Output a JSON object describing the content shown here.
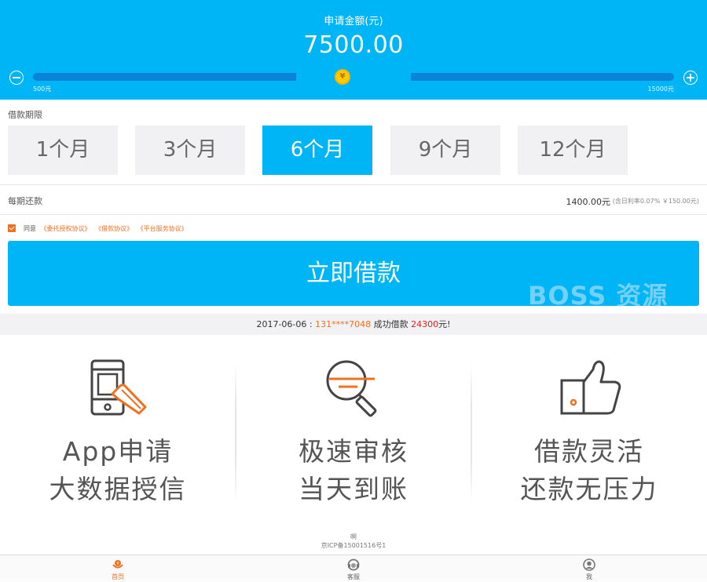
{
  "amount": {
    "title": "申请金额(元)",
    "value": "7500.00",
    "min_label": "500元",
    "max_label": "15000元",
    "coin_symbol": "¥",
    "slider_fraction": 0.48
  },
  "term": {
    "label": "借款期限",
    "options": [
      "1个月",
      "3个月",
      "6个月",
      "9个月",
      "12个月"
    ],
    "selected_index": 2
  },
  "repayment": {
    "label": "每期还款",
    "value": "1400.00元",
    "note": "(含日利率0.07% ￥150.00元)"
  },
  "agreement": {
    "checked": true,
    "prefix": "同意",
    "links": [
      "《委托授权协议》",
      "《借款协议》",
      "《平台服务协议》"
    ]
  },
  "cta_label": "立即借款",
  "watermark": "BOSS 资源",
  "ticker": {
    "date": "2017-06-06 : ",
    "phone": "131****7048",
    "middle": " 成功借款 ",
    "amount": "24300",
    "suffix": "元!"
  },
  "features": [
    {
      "icon": "phone-tap-icon",
      "line1": "App申请",
      "line2": "大数据授信"
    },
    {
      "icon": "magnifier-icon",
      "line1": "极速审核",
      "line2": "当天到账"
    },
    {
      "icon": "thumbs-up-icon",
      "line1": "借款灵活",
      "line2": "还款无压力"
    }
  ],
  "footer": {
    "line1": "啊",
    "line2": "京ICP备15001516号1"
  },
  "tabbar": [
    {
      "icon": "home-icon",
      "label": "首页",
      "active": true
    },
    {
      "icon": "customer-service-icon",
      "label": "客服",
      "active": false
    },
    {
      "icon": "user-icon",
      "label": "我",
      "active": false
    }
  ],
  "colors": {
    "primary": "#00b5f5",
    "accent": "#f07020",
    "highlight_red": "#e0201c",
    "track": "#0b84d8"
  }
}
